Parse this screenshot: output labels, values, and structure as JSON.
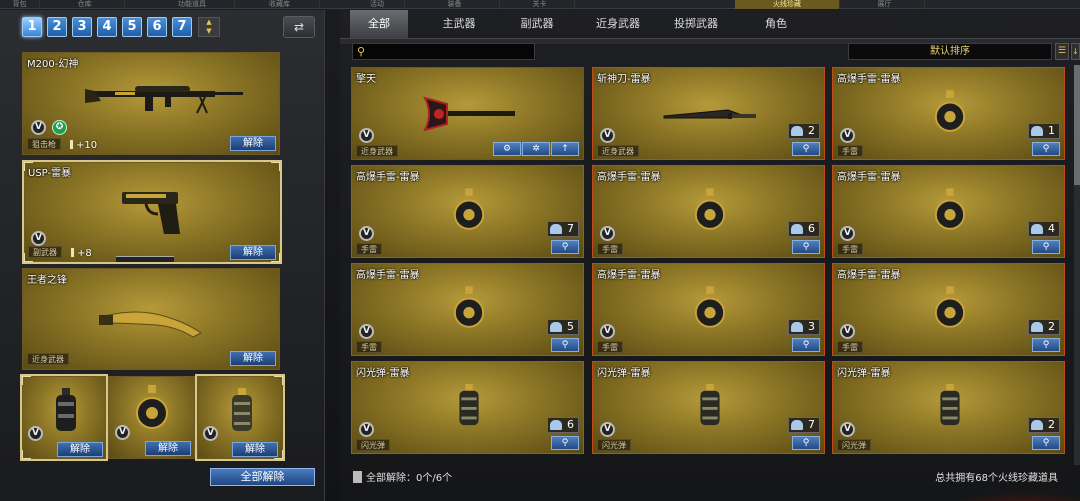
{
  "top_tabs": [
    "背包",
    "仓库",
    "功能道具",
    "收藏库",
    "活动",
    "装备",
    "关卡",
    "火线珍藏",
    "展厅"
  ],
  "left": {
    "number_tabs": [
      "1",
      "2",
      "3",
      "4",
      "5",
      "6",
      "7"
    ],
    "active_tab": "1",
    "cards": [
      {
        "name": "M200-幻神",
        "tag": "狙击枪",
        "plus": "+10",
        "release": "解除"
      },
      {
        "name": "USP-雷暴",
        "tag": "副武器",
        "plus": "+8",
        "release": "解除"
      },
      {
        "name": "王者之锋",
        "tag": "近身武器",
        "release": "解除"
      }
    ],
    "grenade_slots": [
      {
        "release": "解除"
      },
      {
        "release": "解除"
      },
      {
        "release": "解除"
      }
    ],
    "release_all": "全部解除"
  },
  "right": {
    "categories": [
      "全部",
      "主武器",
      "副武器",
      "近身武器",
      "投掷武器",
      "角色"
    ],
    "active_category": "全部",
    "search_placeholder": "",
    "sort_label": "默认排序",
    "items": [
      {
        "name": "擎天",
        "tag": "近身武器",
        "kind": "hammer"
      },
      {
        "name": "斩神刀-雷暴",
        "tag": "近身武器",
        "kind": "blade",
        "count": "2"
      },
      {
        "name": "高爆手雷-雷暴",
        "tag": "手雷",
        "kind": "grenade",
        "count": "1"
      },
      {
        "name": "高爆手雷-雷暴",
        "tag": "手雷",
        "kind": "grenade",
        "count": "7"
      },
      {
        "name": "高爆手雷-雷暴",
        "tag": "手雷",
        "kind": "grenade",
        "count": "6"
      },
      {
        "name": "高爆手雷-雷暴",
        "tag": "手雷",
        "kind": "grenade",
        "count": "4"
      },
      {
        "name": "高爆手雷-雷暴",
        "tag": "手雷",
        "kind": "grenade",
        "count": "5"
      },
      {
        "name": "高爆手雷-雷暴",
        "tag": "手雷",
        "kind": "grenade",
        "count": "3"
      },
      {
        "name": "高爆手雷-雷暴",
        "tag": "手雷",
        "kind": "grenade",
        "count": "2"
      },
      {
        "name": "闪光弹-雷暴",
        "tag": "闪光弹",
        "kind": "flash",
        "count": "6"
      },
      {
        "name": "闪光弹-雷暴",
        "tag": "闪光弹",
        "kind": "flash",
        "count": "7"
      },
      {
        "name": "闪光弹-雷暴",
        "tag": "闪光弹",
        "kind": "flash",
        "count": "2"
      }
    ],
    "footer_left": "全部解除：0个/6个",
    "footer_right": "总共拥有68个火线珍藏道具"
  },
  "colors": {
    "gold_card": "#8a7425",
    "blue_button": "#234b85",
    "accent_yellow": "#e8d070"
  }
}
